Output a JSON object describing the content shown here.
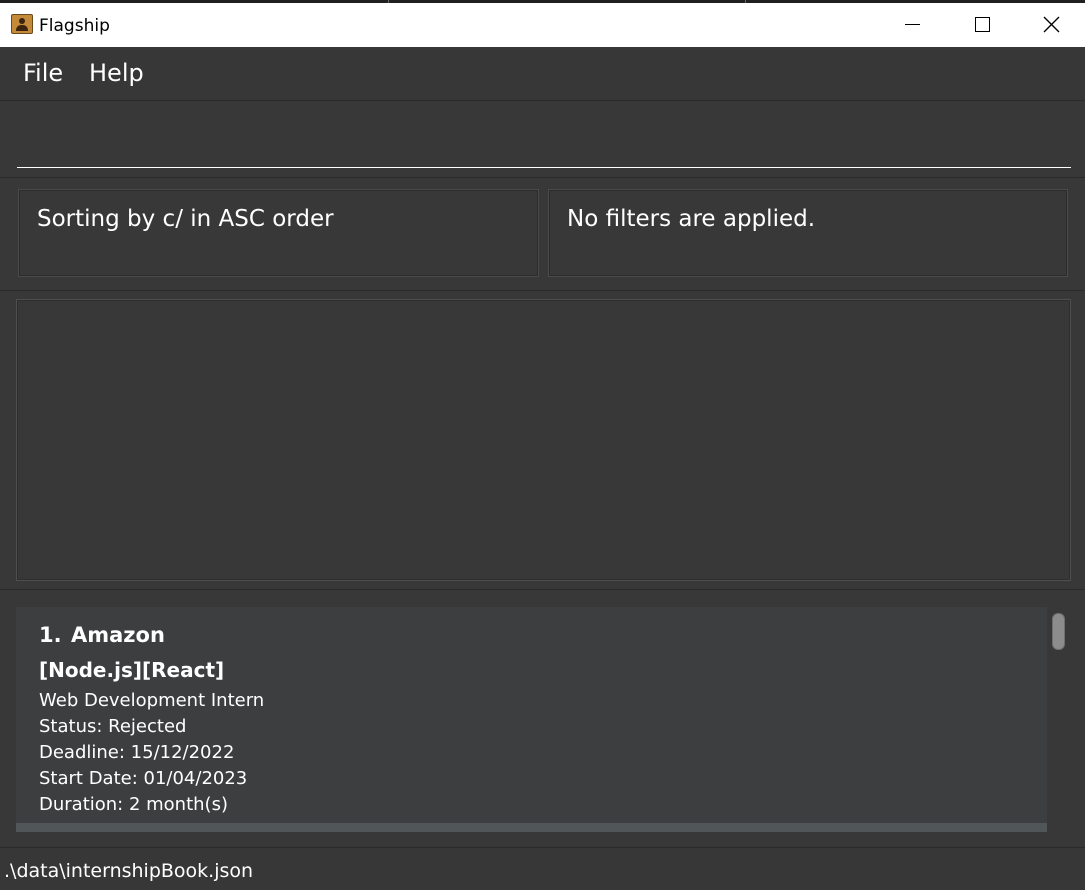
{
  "window": {
    "title": "Flagship"
  },
  "menu": {
    "file": "File",
    "help": "Help"
  },
  "command": {
    "value": ""
  },
  "sort_status": "Sorting by c/ in ASC order",
  "filter_status": "No filters are applied.",
  "result_display": "",
  "internships": [
    {
      "index": "1.",
      "company": "Amazon",
      "tags": "[Node.js][React]",
      "role": "Web Development Intern",
      "status": "Status: Rejected",
      "deadline": "Deadline: 15/12/2022",
      "start_date": "Start Date: 01/04/2023",
      "duration": "Duration: 2 month(s)"
    }
  ],
  "status_bar": {
    "file_path": ".\\data\\internshipBook.json"
  },
  "colors": {
    "background": "#383838",
    "card": "#3c3e3f",
    "text": "#ffffff"
  }
}
